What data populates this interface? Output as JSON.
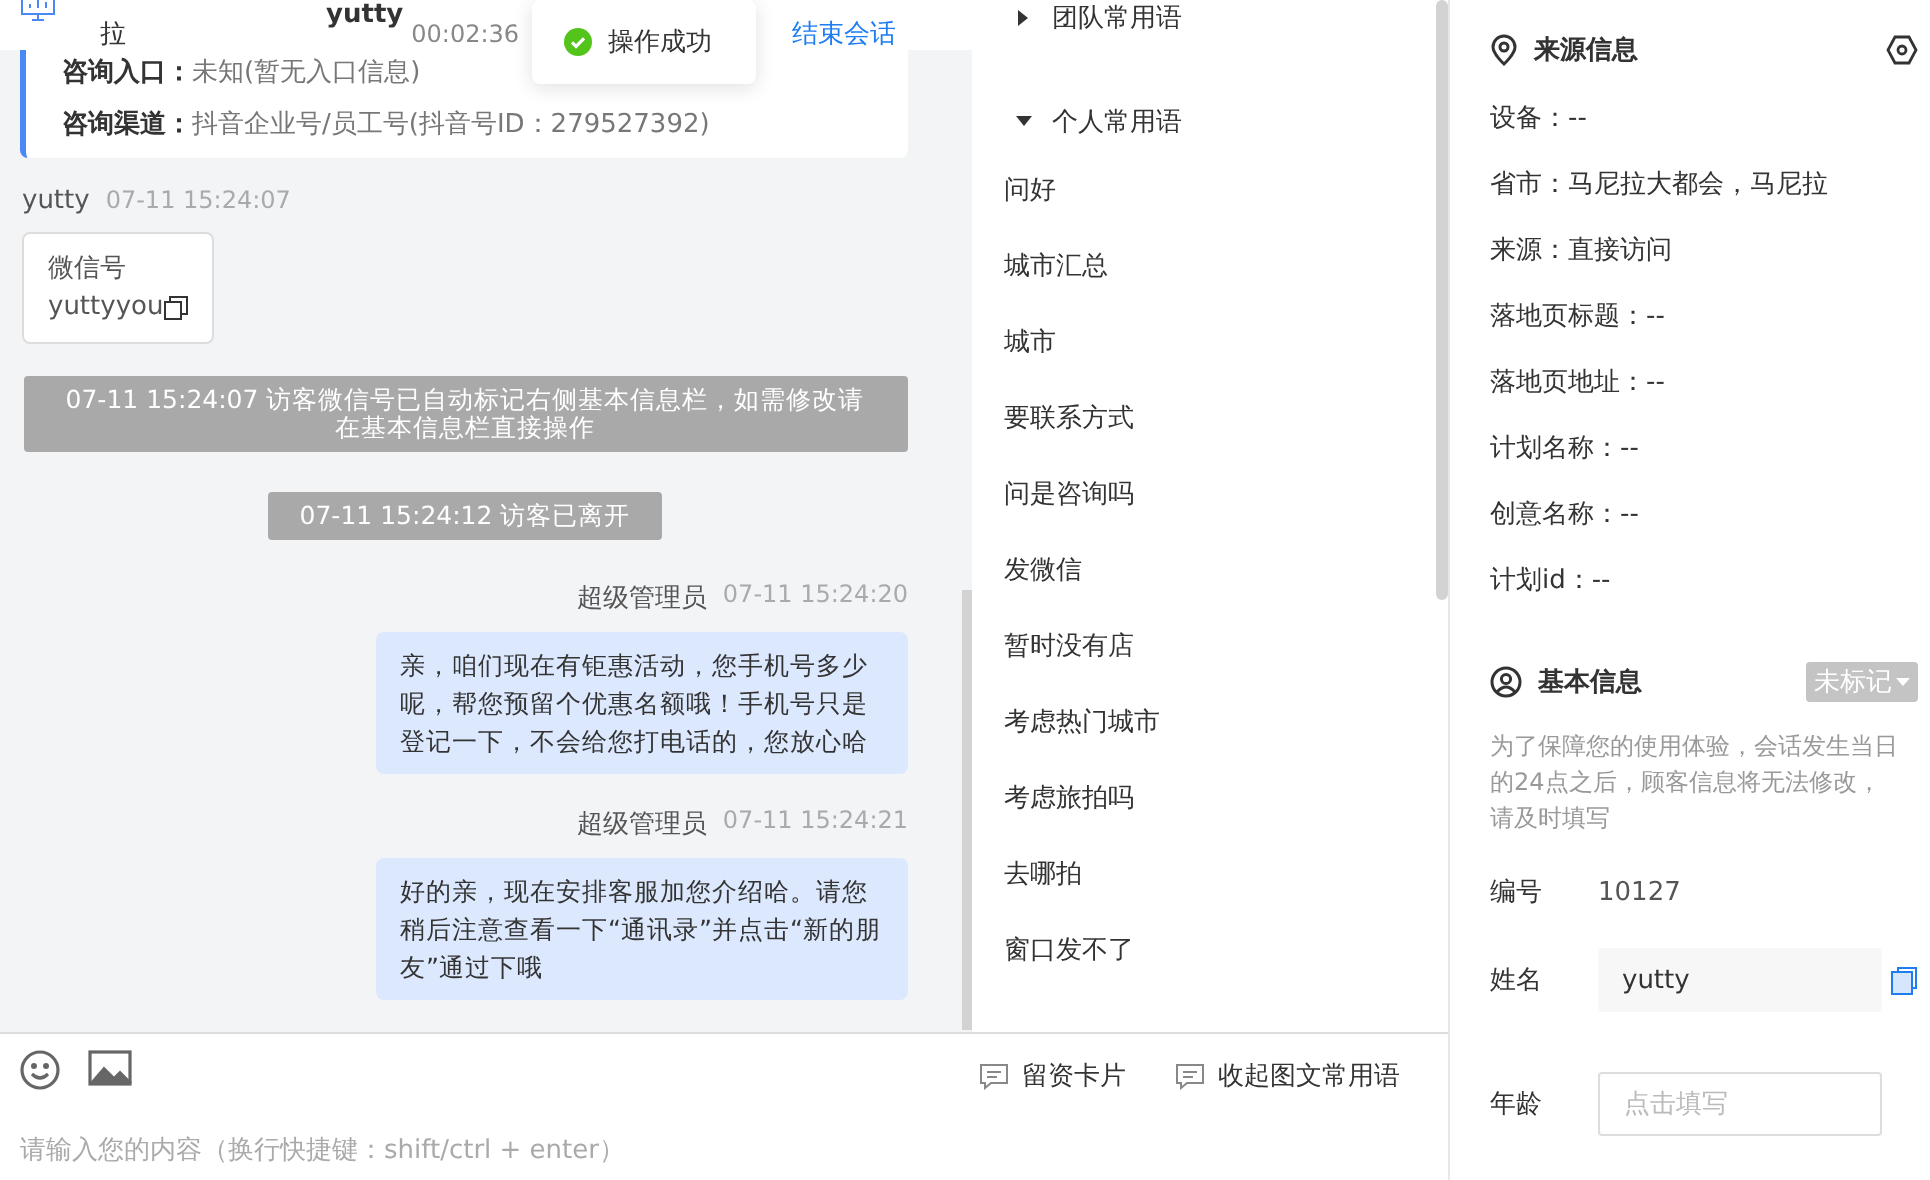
{
  "chat_header": {
    "visitor_location": "拉",
    "visitor_name": "yutty",
    "duration": "00:02:36",
    "end_link": "结束会话"
  },
  "toast": {
    "text": "操作成功"
  },
  "consult_card": {
    "rows": [
      {
        "label": "咨询入口：",
        "value": "未知(暂无入口信息)"
      },
      {
        "label": "咨询渠道：",
        "value": "抖音企业号/员工号(抖音号ID：279527392)"
      }
    ]
  },
  "messages": [
    {
      "kind": "visitor_card",
      "sender": "yutty",
      "time": "07-11 15:24:07",
      "title": "微信号",
      "value": "yuttyyou"
    },
    {
      "kind": "system",
      "text": "07-11 15:24:07 访客微信号已自动标记右侧基本信息栏，如需修改请在基本信息栏直接操作"
    },
    {
      "kind": "system",
      "text": "07-11 15:24:12 访客已离开"
    },
    {
      "kind": "agent",
      "sender": "超级管理员",
      "time": "07-11 15:24:20",
      "text": "亲，咱们现在有钜惠活动，您手机号多少呢，帮您预留个优惠名额哦！手机号只是登记一下，不会给您打电话的，您放心哈"
    },
    {
      "kind": "agent",
      "sender": "超级管理员",
      "time": "07-11 15:24:21",
      "text": "好的亲，现在安排客服加您介绍哈。请您稍后注意查看一下“通讯录”并点击“新的朋友”通过下哦"
    }
  ],
  "phrases": {
    "groups": [
      {
        "label": "团队常用语",
        "expanded": false
      },
      {
        "label": "个人常用语",
        "expanded": true,
        "items": [
          "问好",
          "城市汇总",
          "城市",
          "要联系方式",
          "问是咨询吗",
          "发微信",
          "暂时没有店",
          "考虑热门城市",
          "考虑旅拍吗",
          "去哪拍",
          "窗口发不了"
        ]
      }
    ]
  },
  "composer": {
    "placeholder": "请输入您的内容（换行快捷键：shift/ctrl + enter）",
    "tools": [
      "留资卡片",
      "收起图文常用语"
    ]
  },
  "source_info": {
    "title": "来源信息",
    "rows": [
      "设备：--",
      "省市：马尼拉大都会，马尼拉",
      "来源：直接访问",
      "落地页标题：--",
      "落地页地址：--",
      "计划名称：--",
      "创意名称：--",
      "计划id：--"
    ]
  },
  "basic_info": {
    "title": "基本信息",
    "tag": "未标记",
    "notice": "为了保障您的使用体验，会话发生当日的24点之后，顾客信息将无法修改，请及时填写",
    "fields": [
      {
        "kind": "text",
        "label": "编号",
        "value": "10127"
      },
      {
        "kind": "readonly",
        "label": "姓名",
        "value": "yutty"
      },
      {
        "kind": "input",
        "label": "年龄",
        "placeholder": "点击填写"
      }
    ]
  }
}
